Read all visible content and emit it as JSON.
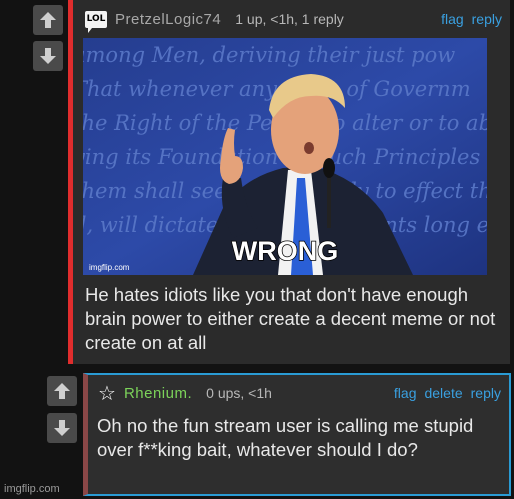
{
  "comment1": {
    "badge": "LOL",
    "username": "PretzelLogic74",
    "meta": "1 up, <1h, 1 reply",
    "actions": [
      "flag",
      "reply"
    ],
    "meme_caption": "WRONG",
    "meme_watermark": "imgflip.com",
    "meme_background_text": [
      "among Men, deriving their just pow",
      "That whenever any Form of Governm",
      "the Right of the People to alter or to abo",
      "ying its Foundation on such Principles a",
      "them shall seem most likely to effect thei",
      "d, will dictate that Governments long esta"
    ],
    "body": "He hates idiots like you that don't have enough brain power to either create a decent meme or not create on at all"
  },
  "comment2": {
    "username": "Rhenium.",
    "meta": "0 ups, <1h",
    "actions": [
      "flag",
      "delete",
      "reply"
    ],
    "body": "Oh no the fun stream user is calling me stupid over f**king bait, whatever should I do?"
  },
  "footer": {
    "watermark": "imgflip.com"
  },
  "colors": {
    "link": "#3aa0e0",
    "comment1_border": "#e02d2d",
    "comment2_border": "#2a9bd4",
    "username2": "#7cd35a"
  },
  "icons": [
    "upvote-arrow-icon",
    "downvote-arrow-icon",
    "lol-badge-icon",
    "star-icon"
  ]
}
